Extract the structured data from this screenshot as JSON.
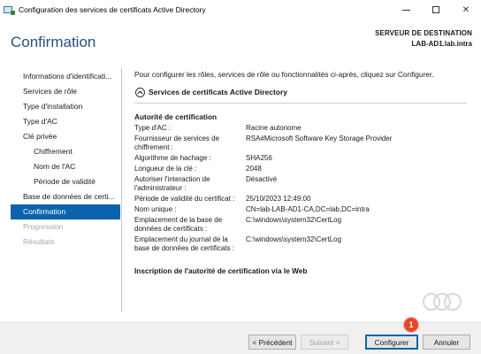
{
  "window": {
    "title": "Configuration des services de certificats Active Directory",
    "minimize": "—",
    "close": "✕"
  },
  "header": {
    "title": "Confirmation",
    "destination_label": "SERVEUR DE DESTINATION",
    "destination_server": "LAB-AD1.lab.intra"
  },
  "sidebar": {
    "items": [
      {
        "label": "Informations d'identificati...",
        "state": "normal",
        "level": 0
      },
      {
        "label": "Services de rôle",
        "state": "normal",
        "level": 0
      },
      {
        "label": "Type d'installation",
        "state": "normal",
        "level": 0
      },
      {
        "label": "Type d'AC",
        "state": "normal",
        "level": 0
      },
      {
        "label": "Clé privée",
        "state": "normal",
        "level": 0
      },
      {
        "label": "Chiffrement",
        "state": "normal",
        "level": 1
      },
      {
        "label": "Nom de l'AC",
        "state": "normal",
        "level": 1
      },
      {
        "label": "Période de validité",
        "state": "normal",
        "level": 1
      },
      {
        "label": "Base de données de certi...",
        "state": "normal",
        "level": 0
      },
      {
        "label": "Confirmation",
        "state": "active",
        "level": 0
      },
      {
        "label": "Progression",
        "state": "disabled",
        "level": 0
      },
      {
        "label": "Résultats",
        "state": "disabled",
        "level": 0
      }
    ]
  },
  "main": {
    "intro": "Pour configurer les rôles, services de rôle ou fonctionnalités ci-après, cliquez sur Configurer.",
    "section_title": "Services de certificats Active Directory",
    "subsection_title": "Autorité de certification",
    "properties": [
      {
        "key": "Type d'AC :",
        "value": "Racine autonome"
      },
      {
        "key": "Fournisseur de services de chiffrement :",
        "value": "RSA#Microsoft Software Key Storage Provider"
      },
      {
        "key": "Algorithme de hachage :",
        "value": "SHA256"
      },
      {
        "key": "Longueur de la clé :",
        "value": "2048"
      },
      {
        "key": "Autoriser l'interaction de l'administrateur :",
        "value": "Désactivé"
      },
      {
        "key": "Période de validité du certificat :",
        "value": "25/10/2023 12:49:00"
      },
      {
        "key": "Nom unique :",
        "value": "CN=lab-LAB-AD1-CA,DC=lab,DC=intra"
      },
      {
        "key": "Emplacement de la base de données de certificats :",
        "value": "C:\\windows\\system32\\CertLog"
      },
      {
        "key": "Emplacement du journal de la base de données de certificats :",
        "value": "C:\\windows\\system32\\CertLog"
      }
    ],
    "web_section_title": "Inscription de l'autorité de certification via le Web"
  },
  "footer": {
    "previous_label": "< Précédent",
    "next_label": "Suivant >",
    "configure_label": "Configurer",
    "cancel_label": "Annuler",
    "step_marker": "1"
  },
  "colors": {
    "accent": "#0a63ad",
    "title_blue": "#2b4f7e",
    "marker": "#e8442a"
  }
}
